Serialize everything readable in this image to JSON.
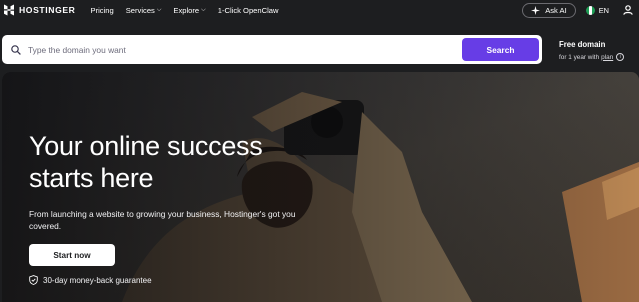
{
  "nav": {
    "logo": "HOSTINGER",
    "items": [
      {
        "label": "Pricing",
        "dropdown": false
      },
      {
        "label": "Services",
        "dropdown": true
      },
      {
        "label": "Explore",
        "dropdown": true
      },
      {
        "label": "1-Click OpenClaw",
        "dropdown": false
      }
    ],
    "ask_ai": "Ask AI",
    "lang": "EN",
    "icons": {
      "logo": "hostinger-logo",
      "ask_ai": "sparkle-icon",
      "lang": "nigeria-flag-icon",
      "account": "user-icon"
    }
  },
  "search": {
    "placeholder": "Type the domain you want",
    "value": "",
    "button": "Search",
    "icon": "search-icon"
  },
  "free_domain": {
    "title": "Free domain",
    "sub_prefix": "for 1 year with",
    "link": "plan"
  },
  "hero": {
    "title": "Your online success starts here",
    "subtitle": "From launching a website to growing your business, Hostinger's got you covered.",
    "cta": "Start now",
    "guarantee": "30-day money-back guarantee"
  },
  "colors": {
    "brand": "#673de6",
    "background": "#1d1e20",
    "text": "#ffffff"
  }
}
